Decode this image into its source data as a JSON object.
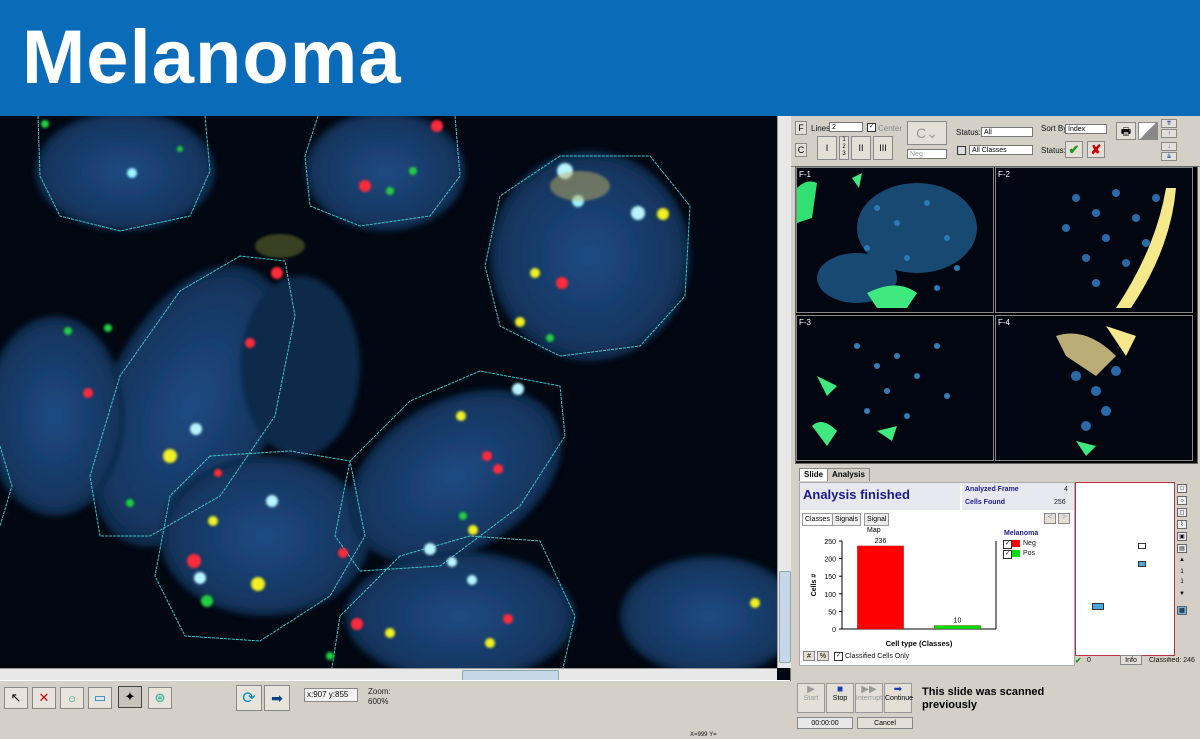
{
  "banner": {
    "title": "Melanoma"
  },
  "viewer": {
    "coords": "x:907 y:855",
    "zoom_label": "Zoom:",
    "zoom_value": "600%"
  },
  "controls": {
    "f_btn": "F",
    "c_btn": "C",
    "lines_label": "Lines:",
    "lines_value": "2",
    "center_label": "Center",
    "roman_1": "I",
    "roman_2": "II",
    "roman_3": "III",
    "neg_select": "Neg",
    "status_label": "Status:",
    "status_value": "All",
    "classes_value": "All Classes",
    "sort_label": "Sort By:",
    "sort_value": "Index",
    "status2_label": "Status:"
  },
  "frames": [
    {
      "label": "F-1"
    },
    {
      "label": "F-2"
    },
    {
      "label": "F-3"
    },
    {
      "label": "F-4"
    }
  ],
  "tabs": {
    "slide": "Slide",
    "analysis": "Analysis"
  },
  "analysis": {
    "title": "Analysis finished",
    "analyzed_label": "Analyzed Frame",
    "analyzed_value": "4",
    "cells_label": "Cells Found",
    "cells_value": "256",
    "subtabs": [
      "Classes",
      "Signals",
      "Signal Map"
    ],
    "legend_title": "Melanoma",
    "legend_neg": "Neg",
    "legend_pos": "Pos",
    "hash_btn": "#",
    "pct_btn": "%",
    "classified_only": "Classified Cells Only"
  },
  "chart_data": {
    "type": "bar",
    "categories": [
      "Neg",
      "Pos"
    ],
    "values": [
      236,
      10
    ],
    "colors": [
      "#ff0000",
      "#00dd00"
    ],
    "xlabel": "Cell type (Classes)",
    "ylabel": "Cells #",
    "ylim": [
      0,
      250
    ],
    "yticks": [
      0,
      50,
      100,
      150,
      200,
      250
    ]
  },
  "map": {
    "count_left": "0",
    "info_btn": "Info",
    "classified": "Classified: 246"
  },
  "scan": {
    "start": "Start",
    "stop": "Stop",
    "interrupt": "Interrupt",
    "continue": "Continue",
    "message": "This slide was scanned previously",
    "time": "00:00:00",
    "cancel": "Cancel"
  },
  "footer": {
    "xy": "X=999  Y="
  }
}
